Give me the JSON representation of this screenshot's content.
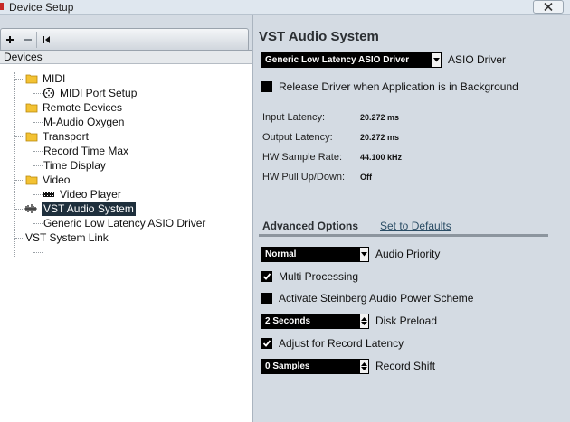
{
  "window": {
    "title": "Device Setup",
    "close_glyph": "close-icon"
  },
  "toolbar": {
    "add_icon": "plus-icon",
    "remove_icon": "minus-icon",
    "reset_icon": "reset-icon"
  },
  "tree": {
    "header": "Devices",
    "items": [
      {
        "label": "MIDI",
        "icon": "folder-icon"
      },
      {
        "label": "MIDI Port Setup",
        "icon": "midi-port-icon"
      },
      {
        "label": "Remote Devices",
        "icon": "folder-icon"
      },
      {
        "label": "M-Audio Oxygen",
        "icon": ""
      },
      {
        "label": "Transport",
        "icon": "folder-icon"
      },
      {
        "label": "Record Time Max",
        "icon": ""
      },
      {
        "label": "Time Display",
        "icon": ""
      },
      {
        "label": "Video",
        "icon": "folder-icon"
      },
      {
        "label": "Video Player",
        "icon": "video-icon"
      },
      {
        "label": "VST Audio System",
        "icon": "audio-system-icon",
        "selected": true
      },
      {
        "label": "Generic Low Latency ASIO Driver",
        "icon": ""
      },
      {
        "label": "VST System Link",
        "icon": ""
      }
    ]
  },
  "panel": {
    "title": "VST Audio System",
    "asio_driver": {
      "value": "Generic Low Latency ASIO Driver",
      "label": "ASIO Driver"
    },
    "release_driver": {
      "label": "Release Driver when Application is in Background",
      "checked": false
    },
    "info": [
      {
        "label": "Input Latency:",
        "value": "20.272 ms"
      },
      {
        "label": "Output Latency:",
        "value": "20.272 ms"
      },
      {
        "label": "HW Sample Rate:",
        "value": "44.100 kHz"
      },
      {
        "label": "HW Pull Up/Down:",
        "value": "Off"
      }
    ],
    "advanced": {
      "title": "Advanced Options",
      "defaults_link": "Set to Defaults",
      "audio_priority": {
        "value": "Normal",
        "label": "Audio Priority"
      },
      "multi_processing": {
        "label": "Multi Processing",
        "checked": true
      },
      "power_scheme": {
        "label": "Activate Steinberg Audio Power Scheme",
        "checked": false
      },
      "disk_preload": {
        "value": "2 Seconds",
        "label": "Disk Preload"
      },
      "record_latency": {
        "label": "Adjust for Record Latency",
        "checked": true
      },
      "record_shift": {
        "value": "0 Samples",
        "label": "Record Shift"
      }
    }
  },
  "colors": {
    "selection": "#1e2f3c",
    "panel_bg": "#d4dbe3",
    "link": "#2c4e66"
  }
}
